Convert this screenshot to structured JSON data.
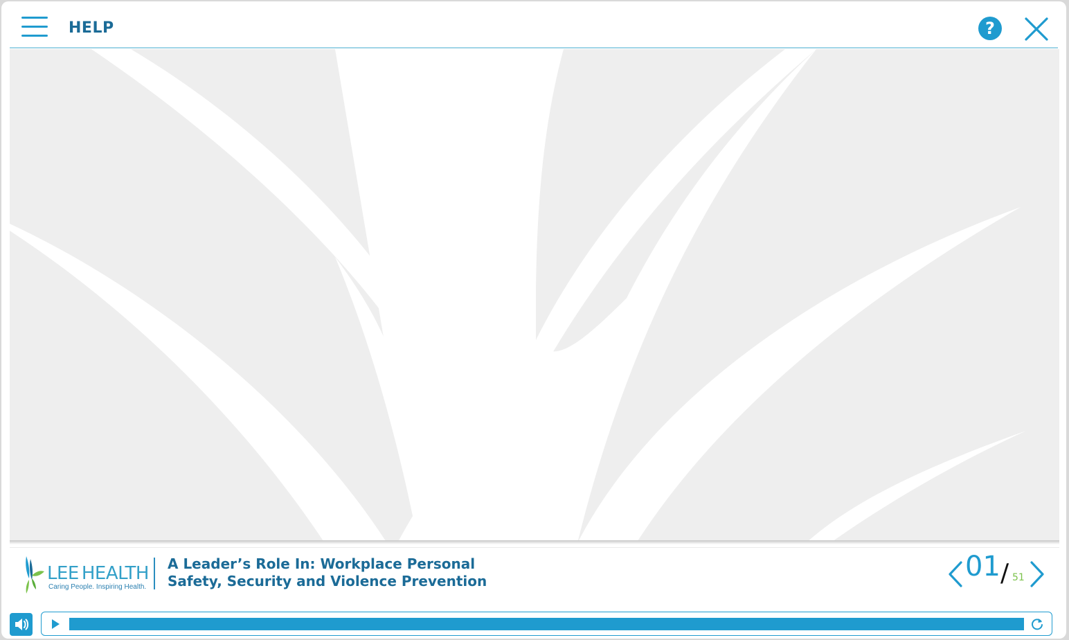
{
  "header": {
    "help_label": "HELP",
    "help_button_glyph": "?",
    "icons": {
      "menu": "hamburger-menu-icon",
      "help": "question-circle-icon",
      "close": "close-x-icon"
    }
  },
  "slide": {
    "background_color": "#eeeeee",
    "leaf_color": "#ffffff"
  },
  "footer": {
    "logo": {
      "brand_word_1": "LEE",
      "brand_word_2": "HEALTH",
      "tagline": "Caring People. Inspiring Health."
    },
    "course_title_line1": "A Leader’s Role In: Workplace Personal",
    "course_title_line2": "Safety, Security and Violence Prevention",
    "pager": {
      "current": "01",
      "separator": "/",
      "total": "51",
      "icons": {
        "prev": "chevron-left-icon",
        "next": "chevron-right-icon"
      }
    }
  },
  "player": {
    "progress_fraction": 1.0,
    "icons": {
      "mute": "speaker-icon",
      "play": "play-icon",
      "replay": "replay-icon"
    }
  },
  "colors": {
    "accent": "#1f9bcf",
    "title": "#1b6b97",
    "brand_green": "#7bc24b"
  }
}
